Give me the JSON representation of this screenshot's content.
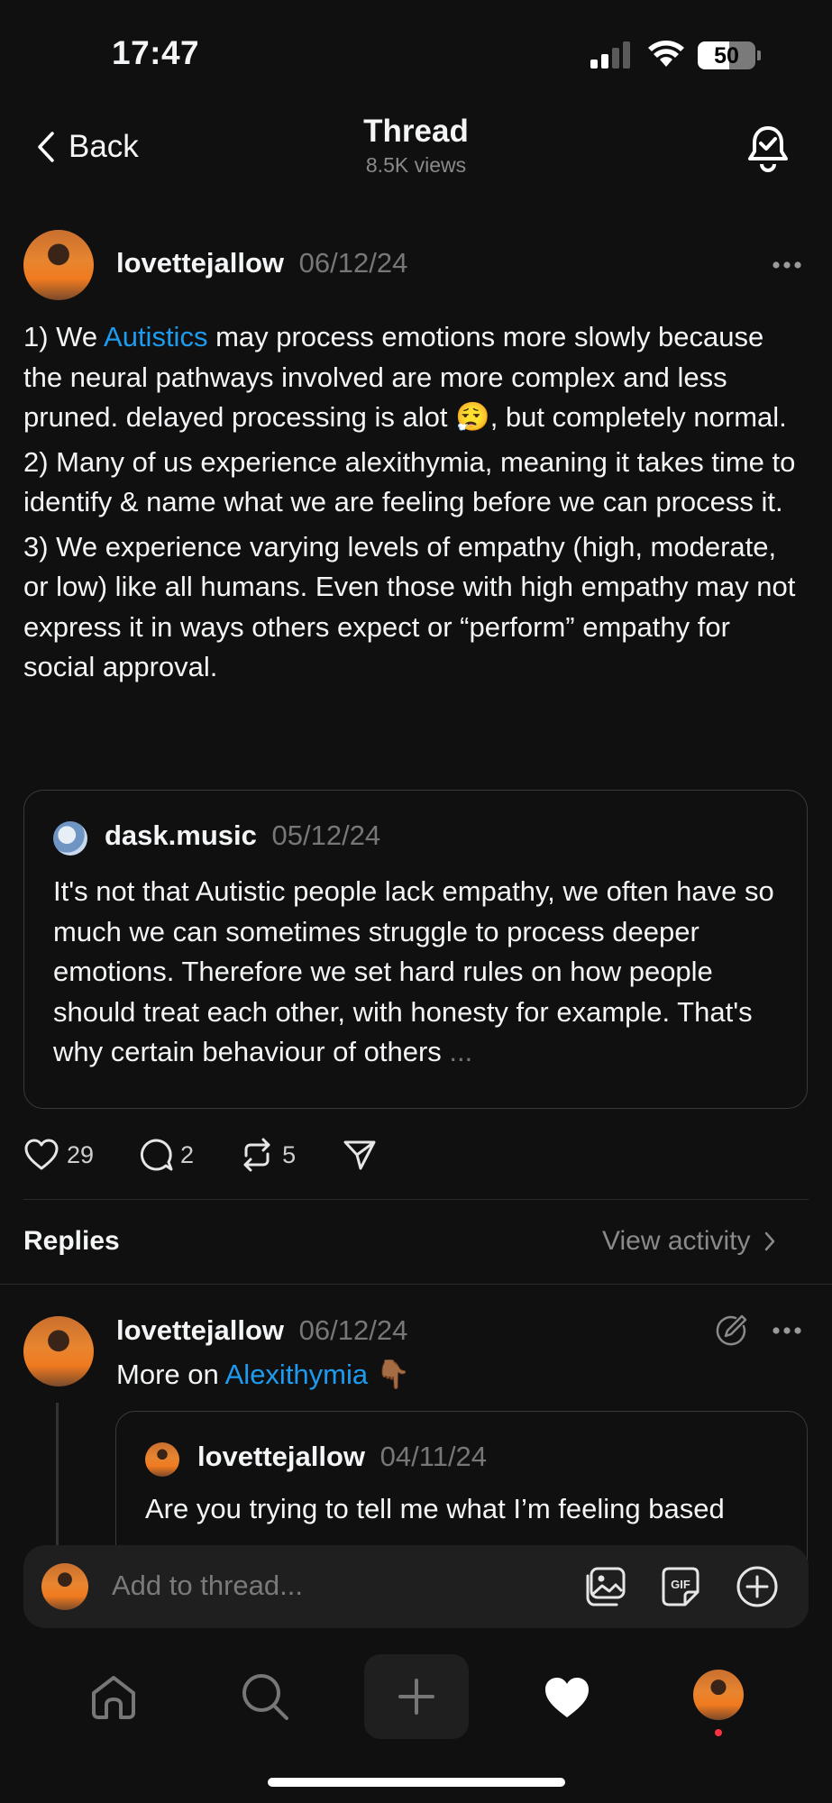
{
  "status_bar": {
    "time": "17:47",
    "battery": "50"
  },
  "nav": {
    "back_label": "Back",
    "title": "Thread",
    "views": "8.5K views"
  },
  "post": {
    "username": "lovettejallow",
    "date": "06/12/24",
    "line1_pre": "1) We ",
    "line1_link": "Autistics",
    "line1_post": " may process emotions more slowly because the neural pathways involved are more complex and less pruned. delayed processing is alot ",
    "emoji": "😮‍💨",
    "line1_end": ", but completely normal.",
    "para2": "2) Many of us experience alexithymia, meaning it takes time to identify & name what we are feeling before we can process it.",
    "para3": "3) We experience varying levels of empathy (high, moderate, or low) like all humans. Even those with high empathy may not express it in ways others expect or “perform” empathy for social approval."
  },
  "quote": {
    "username": "dask.music",
    "date": "05/12/24",
    "text": "It's not that Autistic people lack empathy, we often have so much we can sometimes struggle to process deeper emotions. Therefore we set hard rules on how people should treat each other, with honesty for example. That's why certain behaviour of others",
    "ellipsis": "..."
  },
  "actions": {
    "likes": "29",
    "comments": "2",
    "reposts": "5"
  },
  "replies_header": {
    "label": "Replies",
    "view_activity": "View activity"
  },
  "reply": {
    "username": "lovettejallow",
    "date": "06/12/24",
    "text_pre": "More on ",
    "text_link": "Alexithymia",
    "emoji": "👇🏾",
    "nested": {
      "username": "lovettejallow",
      "date": "04/11/24",
      "text": "Are you trying to tell me what I’m feeling based"
    }
  },
  "composer": {
    "placeholder": "Add to thread..."
  }
}
